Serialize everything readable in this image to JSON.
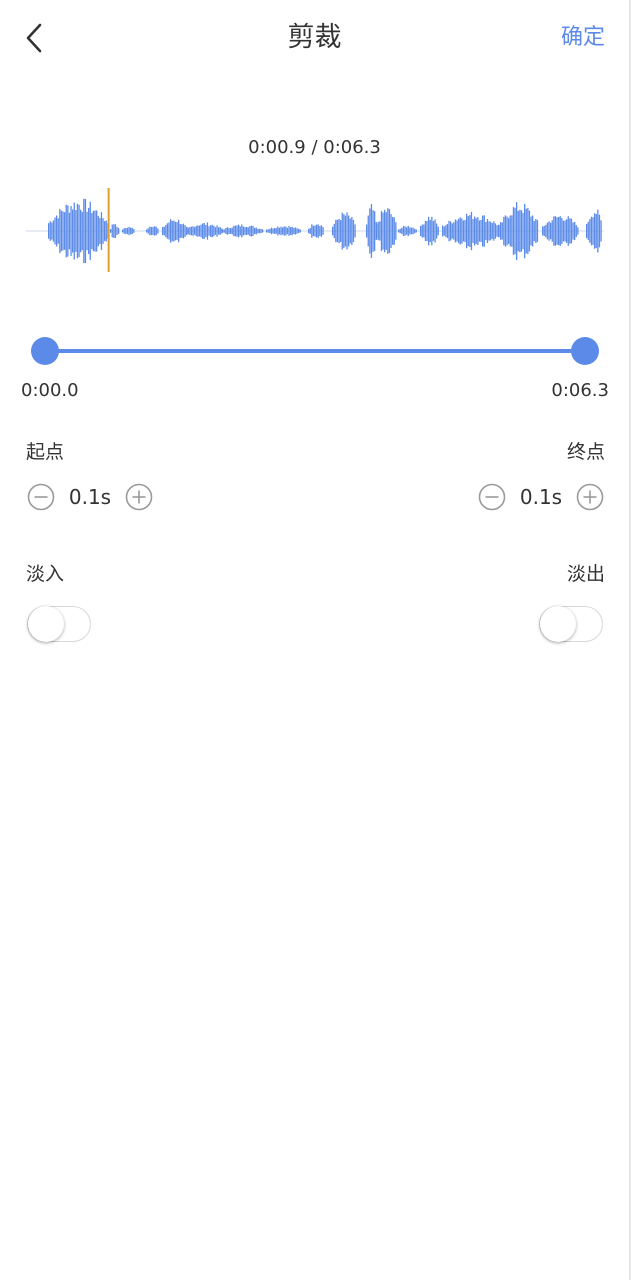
{
  "header": {
    "title": "剪裁",
    "confirm_label": "确定",
    "back_icon": "chevron-left-icon"
  },
  "playback": {
    "readout": "0:00.9 / 0:06.3",
    "playhead_fraction": 0.143,
    "playhead_color": "#e0a030"
  },
  "waveform": {
    "color": "#5b8ae8"
  },
  "range": {
    "start_label": "0:00.0",
    "end_label": "0:06.3",
    "start_fraction": 0.0,
    "end_fraction": 1.0
  },
  "start_point": {
    "label": "起点",
    "value": "0.1s"
  },
  "end_point": {
    "label": "终点",
    "value": "0.1s"
  },
  "fade_in": {
    "label": "淡入",
    "enabled": false
  },
  "fade_out": {
    "label": "淡出",
    "enabled": false
  },
  "colors": {
    "accent": "#5b8ae8",
    "text": "#333333",
    "icon_gray": "#9a9a9a"
  }
}
